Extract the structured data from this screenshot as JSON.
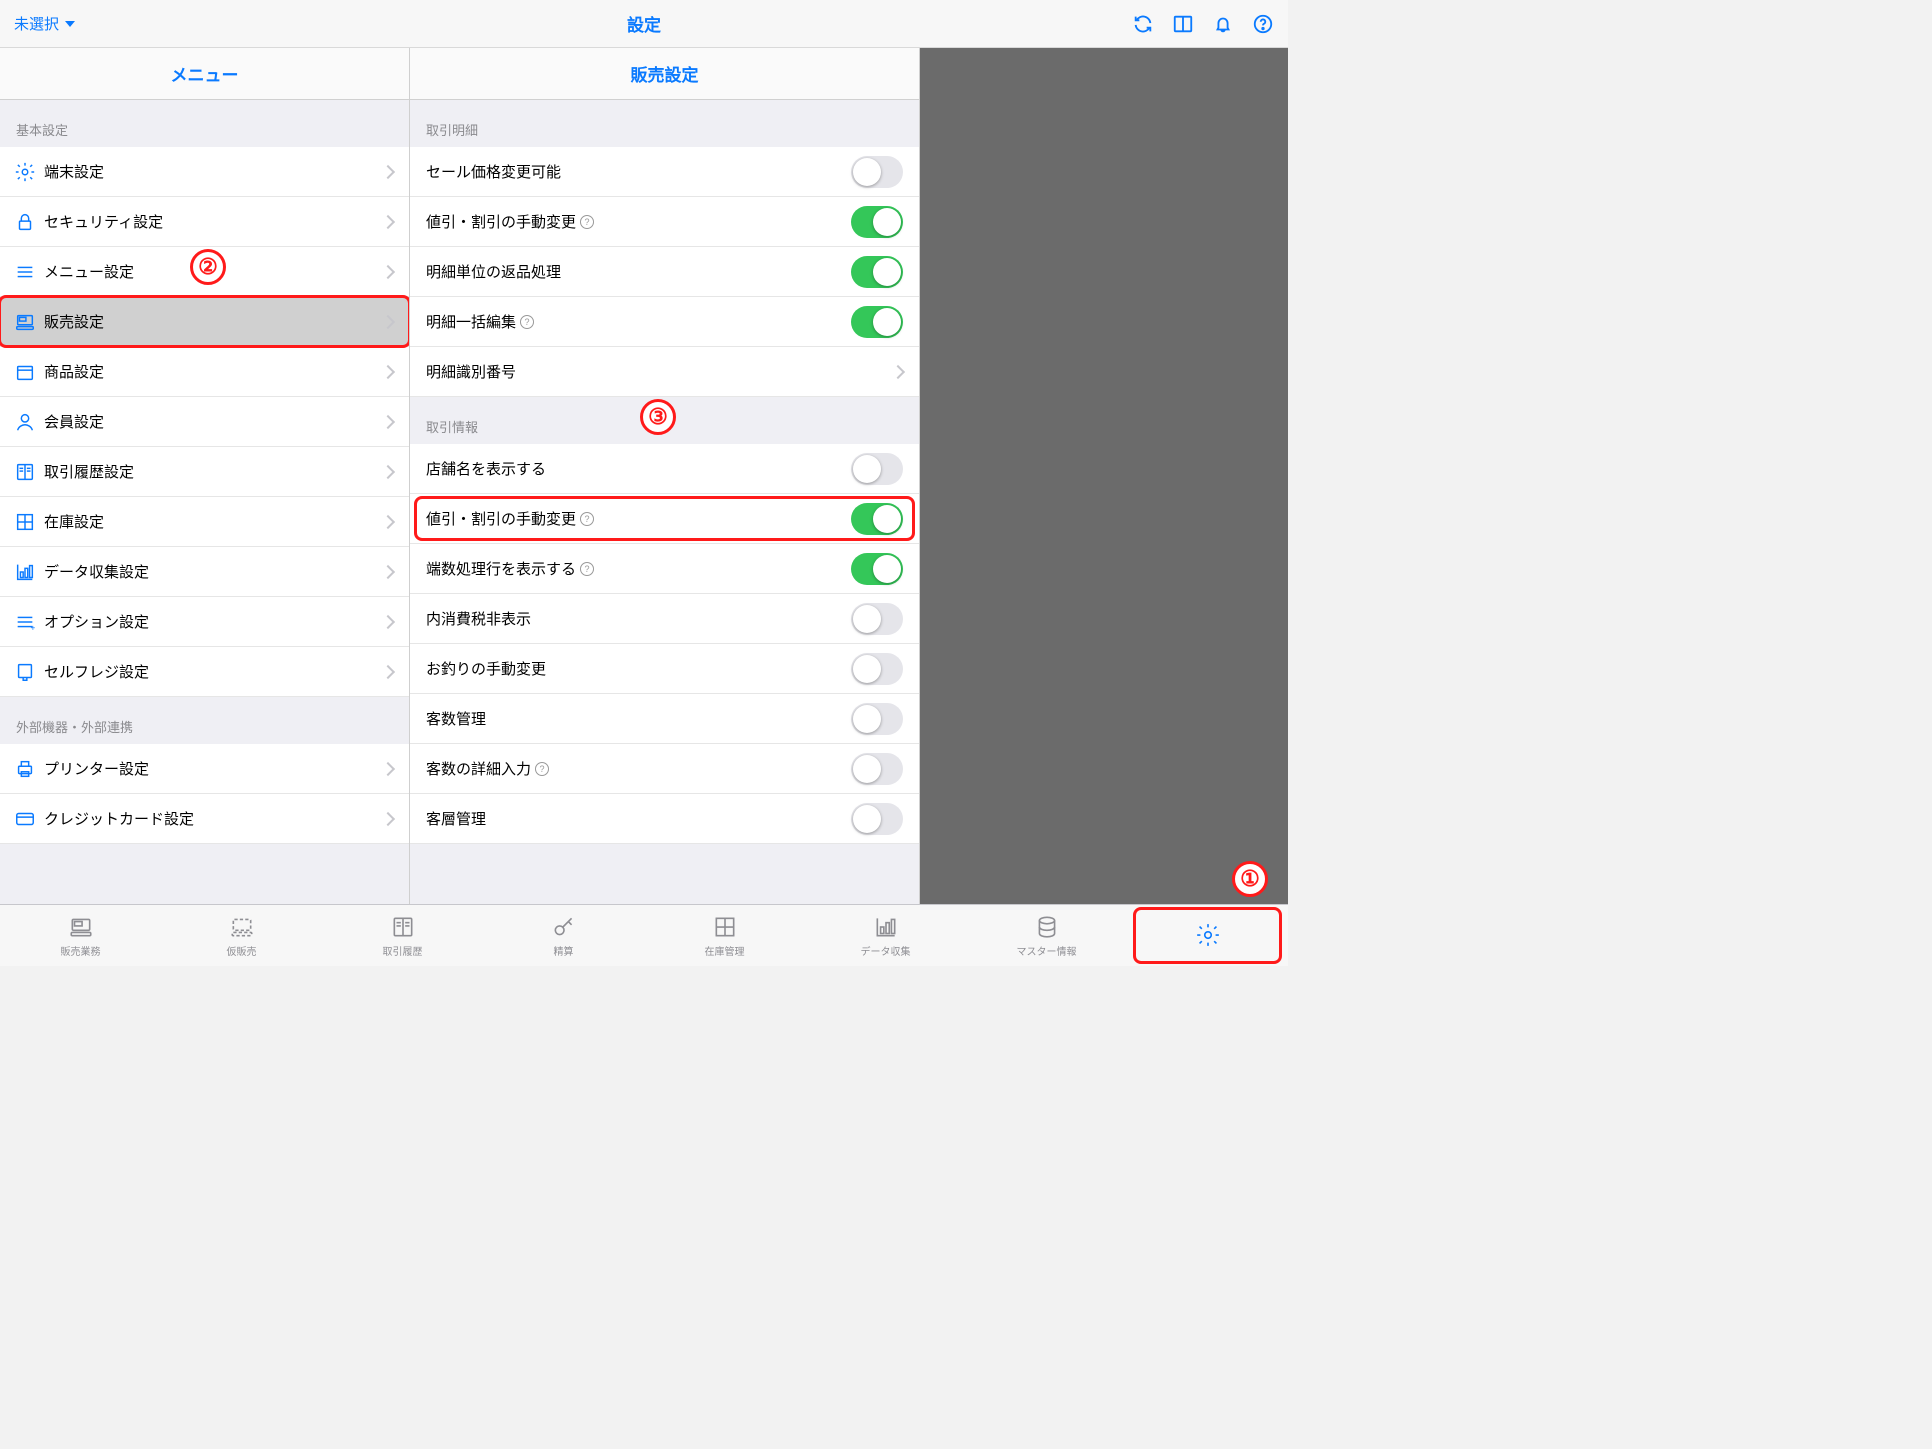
{
  "topnav": {
    "left_label": "未選択",
    "title": "設定"
  },
  "menu": {
    "header": "メニュー",
    "groups": [
      {
        "title": "基本設定",
        "items": [
          {
            "icon": "gear",
            "label": "端末設定"
          },
          {
            "icon": "lock",
            "label": "セキュリティ設定"
          },
          {
            "icon": "list",
            "label": "メニュー設定"
          },
          {
            "icon": "register",
            "label": "販売設定",
            "selected": true,
            "highlight": true,
            "annot": "②"
          },
          {
            "icon": "box",
            "label": "商品設定"
          },
          {
            "icon": "person",
            "label": "会員設定"
          },
          {
            "icon": "book",
            "label": "取引履歴設定"
          },
          {
            "icon": "grid",
            "label": "在庫設定"
          },
          {
            "icon": "graph",
            "label": "データ収集設定"
          },
          {
            "icon": "options",
            "label": "オプション設定"
          },
          {
            "icon": "kiosk",
            "label": "セルフレジ設定"
          }
        ]
      },
      {
        "title": "外部機器・外部連携",
        "items": [
          {
            "icon": "printer",
            "label": "プリンター設定"
          },
          {
            "icon": "card",
            "label": "クレジットカード設定"
          }
        ]
      }
    ]
  },
  "detail": {
    "header": "販売設定",
    "groups": [
      {
        "title": "取引明細",
        "rows": [
          {
            "label": "セール価格変更可能",
            "type": "switch",
            "on": false,
            "help": false
          },
          {
            "label": "値引・割引の手動変更",
            "type": "switch",
            "on": true,
            "help": true
          },
          {
            "label": "明細単位の返品処理",
            "type": "switch",
            "on": true,
            "help": false
          },
          {
            "label": "明細一括編集",
            "type": "switch",
            "on": true,
            "help": true
          },
          {
            "label": "明細識別番号",
            "type": "nav",
            "help": false
          }
        ]
      },
      {
        "title": "取引情報",
        "annot": "③",
        "rows": [
          {
            "label": "店舗名を表示する",
            "type": "switch",
            "on": false,
            "help": false
          },
          {
            "label": "値引・割引の手動変更",
            "type": "switch",
            "on": true,
            "help": true,
            "highlight": true
          },
          {
            "label": "端数処理行を表示する",
            "type": "switch",
            "on": true,
            "help": true
          },
          {
            "label": "内消費税非表示",
            "type": "switch",
            "on": false,
            "help": false
          },
          {
            "label": "お釣りの手動変更",
            "type": "switch",
            "on": false,
            "help": false
          },
          {
            "label": "客数管理",
            "type": "switch",
            "on": false,
            "help": false
          },
          {
            "label": "客数の詳細入力",
            "type": "switch",
            "on": false,
            "help": true
          },
          {
            "label": "客層管理",
            "type": "switch",
            "on": false,
            "help": false
          }
        ]
      }
    ]
  },
  "tabs": [
    {
      "icon": "register",
      "label": "販売業務"
    },
    {
      "icon": "register-dashed",
      "label": "仮販売"
    },
    {
      "icon": "book",
      "label": "取引履歴"
    },
    {
      "icon": "key",
      "label": "精算"
    },
    {
      "icon": "grid",
      "label": "在庫管理"
    },
    {
      "icon": "graph",
      "label": "データ収集"
    },
    {
      "icon": "db",
      "label": "マスター情報"
    },
    {
      "icon": "gear",
      "label": "",
      "active": true,
      "highlight": true,
      "annot": "①"
    }
  ],
  "colors": {
    "accent": "#0a7aff",
    "switch_on": "#34c759",
    "highlight": "#ff1a1a"
  }
}
